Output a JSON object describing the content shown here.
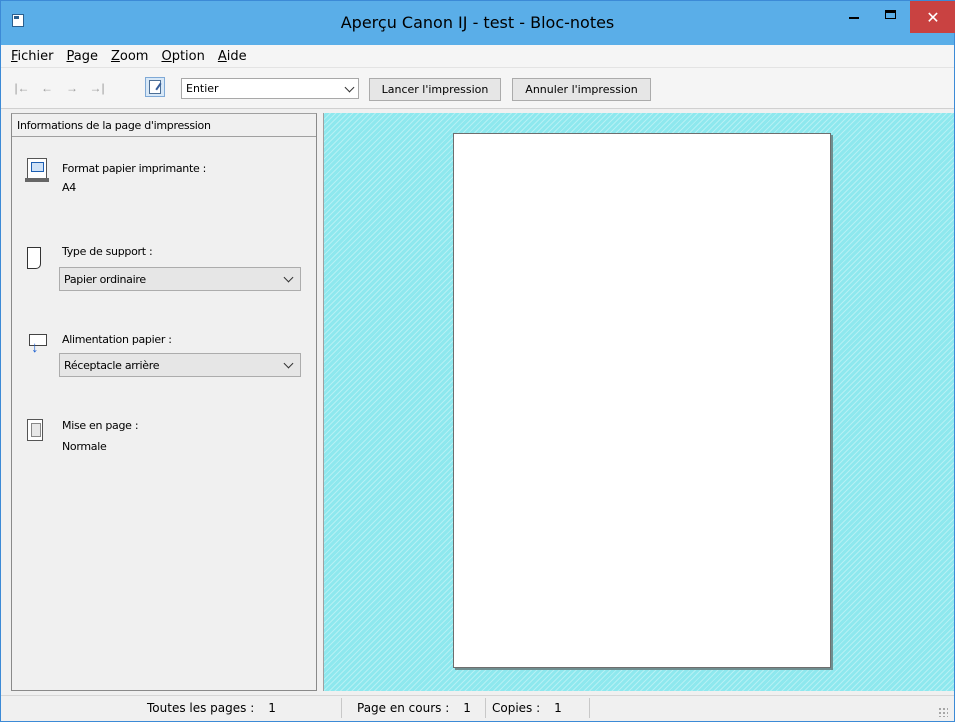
{
  "window": {
    "title": "Aperçu Canon IJ - test - Bloc-notes",
    "close_glyph": "✕"
  },
  "menu": [
    "Fichier",
    "Page",
    "Zoom",
    "Option",
    "Aide"
  ],
  "toolbar": {
    "nav": [
      "|←",
      "←",
      "→",
      "→|"
    ],
    "zoom_value": "Entier",
    "print_label": "Lancer l'impression",
    "cancel_label": "Annuler l'impression"
  },
  "panel": {
    "header": "Informations de la page d'impression",
    "paper_format_label": "Format papier imprimante :",
    "paper_format_value": "A4",
    "media_type_label": "Type de support :",
    "media_type_value": "Papier ordinaire",
    "paper_source_label": "Alimentation papier :",
    "paper_source_value": "Réceptacle arrière",
    "layout_label": "Mise en page :",
    "layout_value": "Normale"
  },
  "status": {
    "all_pages_label": "Toutes les pages :",
    "all_pages_value": "1",
    "current_page_label": "Page en cours :",
    "current_page_value": "1",
    "copies_label": "Copies :",
    "copies_value": "1"
  }
}
